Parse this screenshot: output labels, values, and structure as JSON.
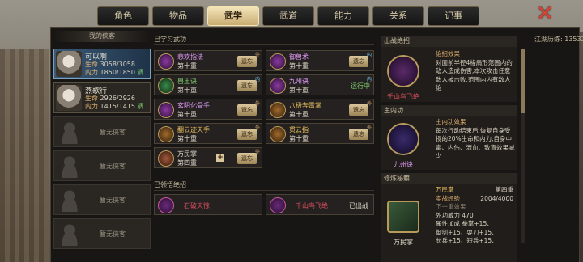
{
  "tabs": [
    {
      "label": "角色",
      "active": false
    },
    {
      "label": "物品",
      "active": false
    },
    {
      "label": "武学",
      "active": true
    },
    {
      "label": "武道",
      "active": false
    },
    {
      "label": "能力",
      "active": false
    },
    {
      "label": "关系",
      "active": false
    },
    {
      "label": "记事",
      "active": false
    }
  ],
  "roster": {
    "title": "我的侠客",
    "heroes": [
      {
        "name": "可以啊",
        "hp_label": "生命",
        "hp": "3058/3058",
        "mp_label": "内力",
        "mp": "1850/1850",
        "adj": "调"
      },
      {
        "name": "燕歌行",
        "hp_label": "生命",
        "hp": "2926/2926",
        "mp_label": "内力",
        "mp": "1415/1415",
        "adj": "调"
      }
    ],
    "empty_label": "暂无侠客"
  },
  "learned": {
    "title": "已学习武功",
    "xp_label": "江湖历练:",
    "xp_value": "13532",
    "skills": [
      {
        "name": "悲欢指法",
        "level": "第十重",
        "button": "遗忘",
        "tag": "外",
        "color": "#e8a0ff"
      },
      {
        "name": "御兽术",
        "level": "第十重",
        "button": "遗忘",
        "tag": "内",
        "color": "#e8a0ff"
      },
      {
        "name": "兽王诀",
        "level": "第十重",
        "button": "遗忘",
        "tag": "内",
        "color": "#7fd070"
      },
      {
        "name": "九州诀",
        "level": "第十重",
        "status": "运行中",
        "tag": "内",
        "color": "#e8a0ff"
      },
      {
        "name": "玄阴化骨手",
        "level": "第十重",
        "button": "遗忘",
        "tag": "外",
        "color": "#e8a0ff"
      },
      {
        "name": "八极奔雷掌",
        "level": "第十重",
        "button": "遗忘",
        "tag": "外",
        "color": "#e8c060"
      },
      {
        "name": "翻云迹天手",
        "level": "第十重",
        "button": "遗忘",
        "tag": "外",
        "color": "#e8c060"
      },
      {
        "name": "贯云指",
        "level": "第十重",
        "button": "遗忘",
        "tag": "外",
        "color": "#e8c060"
      },
      {
        "name": "万民掌",
        "level": "第四重",
        "button": "遗忘",
        "tag": "外",
        "color": "#e8e0d0",
        "plus": "+"
      }
    ]
  },
  "ultimates": {
    "title": "已领悟绝招",
    "items": [
      {
        "name": "石破天惊",
        "status": ""
      },
      {
        "name": "千山鸟飞绝",
        "status": "已出战"
      }
    ]
  },
  "right_panel": {
    "battle_title": "出战绝招",
    "battle_skill": "千山鸟飞绝",
    "battle_desc_title": "绝招效果",
    "battle_desc": "对面前半径4格扇形范围内的敌人造成伤害,本次攻击任意敌人被击败,范围内内有敌人绝",
    "inner_title": "主内功",
    "inner_skill": "九州诀",
    "inner_desc_title": "主内功效果",
    "inner_desc": "每次行动结束后,恢复自身受损的20%生命和内力,自身中毒、内伤、流血、致盲效果减少",
    "train_title": "修炼秘籍",
    "train_skill": "万民掌",
    "train_name": "万民掌",
    "train_level": "第四重",
    "train_xp_label": "实战经验",
    "train_xp": "2004/4000",
    "next_label": "下一重效果",
    "outer_power": "外功威力 470",
    "attr_label": "属性加成",
    "attr_lines": [
      "拳掌+15、",
      "御剑+15、耍刀+15、",
      "长兵+15、短兵+15、"
    ]
  }
}
